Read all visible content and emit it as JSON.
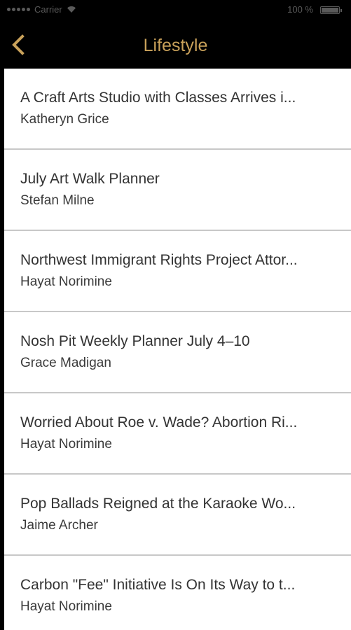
{
  "status_bar": {
    "carrier": "Carrier",
    "battery": "100 %"
  },
  "nav": {
    "title": "Lifestyle",
    "accent_color": "#c9a15a"
  },
  "articles": [
    {
      "title": "A Craft Arts Studio with Classes Arrives i...",
      "author": "Katheryn Grice"
    },
    {
      "title": "July Art Walk Planner",
      "author": "Stefan Milne"
    },
    {
      "title": "Northwest Immigrant Rights Project Attor...",
      "author": "Hayat Norimine"
    },
    {
      "title": "Nosh Pit Weekly Planner July 4–10",
      "author": "Grace Madigan"
    },
    {
      "title": "Worried About Roe v. Wade? Abortion Ri...",
      "author": "Hayat Norimine"
    },
    {
      "title": "Pop Ballads Reigned at the Karaoke Wo...",
      "author": "Jaime Archer"
    },
    {
      "title": "Carbon \"Fee\" Initiative Is On Its Way to t...",
      "author": "Hayat Norimine"
    }
  ]
}
